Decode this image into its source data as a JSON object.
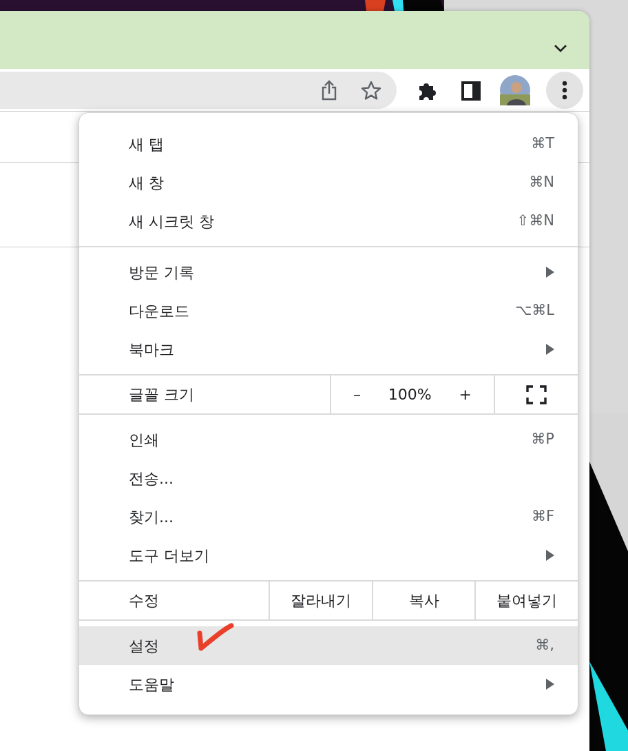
{
  "menu": {
    "sections": [
      {
        "kind": "items",
        "items": [
          {
            "label": "새 탭",
            "shortcut": "⌘T",
            "submenu": false,
            "selected": false
          },
          {
            "label": "새 창",
            "shortcut": "⌘N",
            "submenu": false,
            "selected": false
          },
          {
            "label": "새 시크릿 창",
            "shortcut": "⇧⌘N",
            "submenu": false,
            "selected": false
          }
        ]
      },
      {
        "kind": "items",
        "items": [
          {
            "label": "방문 기록",
            "submenu": true,
            "selected": false
          },
          {
            "label": "다운로드",
            "shortcut": "⌥⌘L",
            "submenu": false,
            "selected": false
          },
          {
            "label": "북마크",
            "submenu": true,
            "selected": false
          }
        ]
      },
      {
        "kind": "zoom",
        "label": "글꼴 크기",
        "minus": "–",
        "value": "100%",
        "plus": "+"
      },
      {
        "kind": "items",
        "items": [
          {
            "label": "인쇄",
            "shortcut": "⌘P",
            "submenu": false,
            "selected": false
          },
          {
            "label": "전송...",
            "submenu": false,
            "selected": false
          },
          {
            "label": "찾기...",
            "shortcut": "⌘F",
            "submenu": false,
            "selected": false
          },
          {
            "label": "도구 더보기",
            "submenu": true,
            "selected": false
          }
        ]
      },
      {
        "kind": "edit",
        "label": "수정",
        "buttons": [
          "잘라내기",
          "복사",
          "붙여넣기"
        ]
      },
      {
        "kind": "items",
        "items": [
          {
            "label": "설정",
            "shortcut": "⌘,",
            "submenu": false,
            "selected": true
          },
          {
            "label": "도움말",
            "submenu": true,
            "selected": false
          }
        ]
      }
    ]
  }
}
